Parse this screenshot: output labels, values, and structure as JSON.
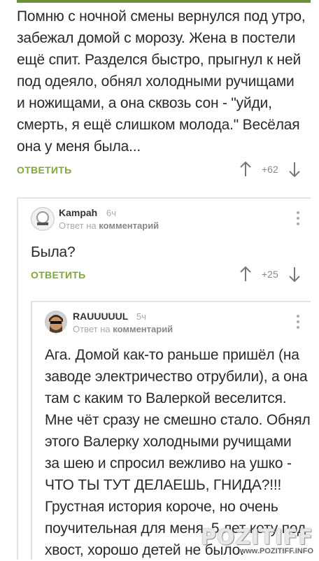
{
  "comments": [
    {
      "text_lines": [
        "Помню с ночной смены вернулся под утро,",
        "забежал домой с морозу. Жена в постели",
        "ещё спит. Разделся быстро, прыгнул к ней",
        "под одеяло, обнял холодными ручищами",
        "и ножищами, а она сквозь сон - \"уйди,",
        "смерть, я ещё слишком молода.\" Весёлая",
        "она у меня была..."
      ],
      "reply_label": "ОТВЕТИТЬ",
      "votes": "+62"
    },
    {
      "username": "Kampah",
      "time": "6ч",
      "subline_prefix": "Ответ на",
      "subline_link": "комментарий",
      "text_lines": [
        "Была?"
      ],
      "reply_label": "ОТВЕТИТЬ",
      "votes": "+25"
    },
    {
      "username": "RAUUUUUL",
      "time": "5ч",
      "subline_prefix": "Ответ на",
      "subline_link": "комментарий",
      "text_lines": [
        "Ага. Домой как-то раньше пришёл (на",
        "заводе электричество отрубили), а она",
        "там с каким то Валеркой веселится.",
        "Мне чёт сразу не смешно стало. Обнял",
        "этого Валерку холодными ручищами",
        "за шею и спросил вежливо на ушко -",
        "ЧТО ТЫ ТУТ ДЕЛАЕШЬ, ГНИДА?!!!",
        "Грустная история короче, но очень",
        "поучительная для меня. 5 лет коту под",
        "хвост, хорошо детей не было."
      ]
    }
  ],
  "watermark": {
    "logo": "POZITIFF",
    "url": "www.POZITIFF.INFO"
  },
  "colors": {
    "accent": "#7da83a",
    "topbar": "#6e8f3a",
    "thread_line": "#e3e3e3"
  }
}
